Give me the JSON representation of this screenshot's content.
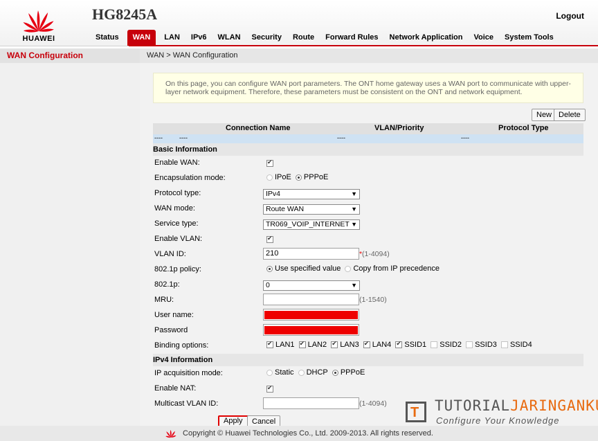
{
  "header": {
    "brand": "HUAWEI",
    "model": "HG8245A",
    "logout": "Logout",
    "nav": [
      "Status",
      "WAN",
      "LAN",
      "IPv6",
      "WLAN",
      "Security",
      "Route",
      "Forward Rules",
      "Network Application",
      "Voice",
      "System Tools"
    ],
    "active_nav": "WAN"
  },
  "sidebar": {
    "item": "WAN Configuration"
  },
  "breadcrumb": "WAN > WAN Configuration",
  "note": "On this page, you can configure WAN port parameters. The ONT home gateway uses a WAN port to communicate with upper-layer network equipment. Therefore, these parameters must be consistent on the ONT and network equipment.",
  "buttons": {
    "new": "New",
    "delete": "Delete",
    "apply": "Apply",
    "cancel": "Cancel"
  },
  "table": {
    "columns": [
      "Connection Name",
      "VLAN/Priority",
      "Protocol Type"
    ],
    "row": [
      "----",
      "----",
      "----",
      "----"
    ]
  },
  "form": {
    "basic_title": "Basic Information",
    "enable_wan": {
      "label": "Enable WAN:",
      "checked": true
    },
    "encap": {
      "label": "Encapsulation mode:",
      "options": [
        "IPoE",
        "PPPoE"
      ],
      "selected": "PPPoE"
    },
    "protocol": {
      "label": "Protocol type:",
      "value": "IPv4"
    },
    "wan_mode": {
      "label": "WAN mode:",
      "value": "Route WAN"
    },
    "service": {
      "label": "Service type:",
      "value": "TR069_VOIP_INTERNET"
    },
    "enable_vlan": {
      "label": "Enable VLAN:",
      "checked": true
    },
    "vlan_id": {
      "label": "VLAN ID:",
      "value": "210",
      "required": "*",
      "hint": "(1-4094)"
    },
    "policy": {
      "label": "802.1p policy:",
      "options": [
        "Use specified value",
        "Copy from IP precedence"
      ],
      "selected": "Use specified value"
    },
    "p8021": {
      "label": "802.1p:",
      "value": "0"
    },
    "mru": {
      "label": "MRU:",
      "value": "",
      "hint": "(1-1540)"
    },
    "username": {
      "label": "User name:"
    },
    "password": {
      "label": "Password"
    },
    "binding": {
      "label": "Binding options:",
      "items": [
        {
          "name": "LAN1",
          "checked": true
        },
        {
          "name": "LAN2",
          "checked": true
        },
        {
          "name": "LAN3",
          "checked": true
        },
        {
          "name": "LAN4",
          "checked": true
        },
        {
          "name": "SSID1",
          "checked": true
        },
        {
          "name": "SSID2",
          "checked": false
        },
        {
          "name": "SSID3",
          "checked": false
        },
        {
          "name": "SSID4",
          "checked": false
        }
      ]
    },
    "ipv4_title": "IPv4 Information",
    "ip_mode": {
      "label": "IP acquisition mode:",
      "options": [
        "Static",
        "DHCP",
        "PPPoE"
      ],
      "selected": "PPPoE"
    },
    "nat": {
      "label": "Enable NAT:",
      "checked": true
    },
    "mvlan": {
      "label": "Multicast VLAN ID:",
      "value": "",
      "hint": "(1-4094)"
    }
  },
  "footer": "Copyright © Huawei Technologies Co., Ltd. 2009-2013. All rights reserved.",
  "watermark": {
    "line1a": "TUTORIAL",
    "line1b": "JARINGANKU",
    "line2": "Configure Your Knowledge",
    "letter": "T"
  },
  "colors": {
    "accent": "#c7000b",
    "note_bg": "#ffffe6",
    "row_highlight": "#cfe2f3"
  }
}
